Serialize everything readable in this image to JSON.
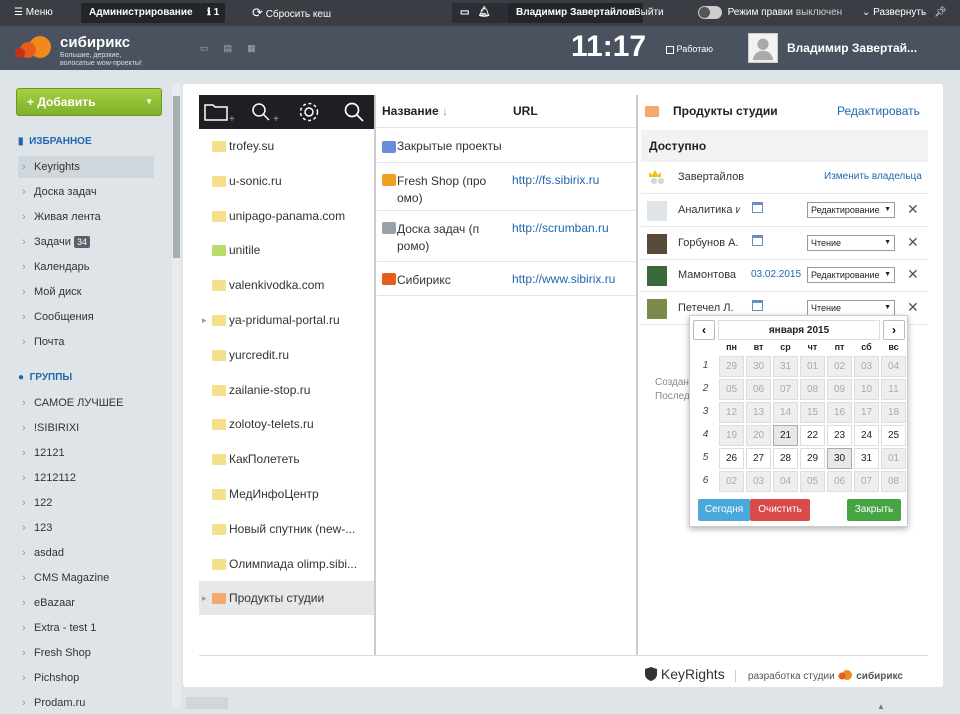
{
  "adminbar": {
    "menu": "Меню",
    "admin": "Администрирование",
    "badge_count": "1",
    "clear_cache": "Сбросить кеш",
    "user": "Владимир Завертайлов",
    "logout": "Выйти",
    "edit_mode_label": "Режим правки",
    "edit_mode_state": "выключен",
    "expand": "Развернуть"
  },
  "header": {
    "logo_name": "сибирикс",
    "logo_tagline_1": "Большие, дерзкие,",
    "logo_tagline_2": "волосатые wow-проекты!",
    "clock": "11:17",
    "working": "Работаю",
    "user_name": "Владимир Завертай..."
  },
  "sidebar": {
    "add_button": "Добавить",
    "favorites_title": "ИЗБРАННОЕ",
    "favorites": [
      {
        "label": "Keyrights"
      },
      {
        "label": "Доска задач"
      },
      {
        "label": "Живая лента"
      },
      {
        "label": "Задачи",
        "count": "34"
      },
      {
        "label": "Календарь"
      },
      {
        "label": "Мой диск"
      },
      {
        "label": "Сообщения"
      },
      {
        "label": "Почта"
      }
    ],
    "groups_title": "ГРУППЫ",
    "groups": [
      {
        "label": "САМОЕ ЛУЧШЕЕ"
      },
      {
        "label": "!SIBIRIXI"
      },
      {
        "label": "12121"
      },
      {
        "label": "1212112"
      },
      {
        "label": "122"
      },
      {
        "label": "123"
      },
      {
        "label": "asdad"
      },
      {
        "label": "CMS Magazine"
      },
      {
        "label": "eBazaar"
      },
      {
        "label": "Extra - test 1"
      },
      {
        "label": "Fresh Shop"
      },
      {
        "label": "Pichshop"
      },
      {
        "label": "Prodam.ru"
      }
    ]
  },
  "folders": [
    {
      "name": "trofey.su",
      "color": "#f5e08a"
    },
    {
      "name": "u-sonic.ru",
      "color": "#f5e08a"
    },
    {
      "name": "unipago-panama.com",
      "color": "#f5e08a"
    },
    {
      "name": "unitile",
      "color": "#b6dd6a"
    },
    {
      "name": "valenkivodka.com",
      "color": "#f5e08a"
    },
    {
      "name": "ya-pridumal-portal.ru",
      "color": "#f5e08a"
    },
    {
      "name": "yurcredit.ru",
      "color": "#f5e08a"
    },
    {
      "name": "zailanie-stop.ru",
      "color": "#f5e08a"
    },
    {
      "name": "zolotoy-telets.ru",
      "color": "#f5e08a"
    },
    {
      "name": "КакПолететь",
      "color": "#f5e08a"
    },
    {
      "name": "МедИнфоЦентр",
      "color": "#f5e08a"
    },
    {
      "name": "Новый спутник (new-...",
      "color": "#f5e08a"
    },
    {
      "name": "Олимпиада olimp.sibi...",
      "color": "#f5e08a"
    },
    {
      "name": "Продукты студии",
      "color": "#f5a86a"
    }
  ],
  "files": {
    "col_name": "Название",
    "col_url": "URL",
    "rows": [
      {
        "name": "Закрытые проекты",
        "url": ""
      },
      {
        "name": "Fresh Shop (про омо)",
        "url": "http://fs.sibirix.ru"
      },
      {
        "name": "Доска задач (п ромо)",
        "url": "http://scrumban.ru"
      },
      {
        "name": "Сибирикс",
        "url": "http://www.sibirix.ru"
      }
    ]
  },
  "access": {
    "title": "Продукты студии",
    "edit": "Редактировать",
    "available": "Доступно",
    "owner_name": "Завертайлов",
    "change_owner": "Изменить владельца",
    "users": [
      {
        "name": "Аналитика и",
        "date": "",
        "perm": "Редактирование"
      },
      {
        "name": "Горбунов А.",
        "date": "",
        "perm": "Чтение"
      },
      {
        "name": "Мамонтова Е",
        "date": "03.02.2015",
        "perm": "Редактирование"
      },
      {
        "name": "Петечел Л.",
        "date": "",
        "perm": "Чтение"
      }
    ],
    "created_label": "Создан",
    "last_label": "Последн"
  },
  "calendar": {
    "month": "января 2015",
    "weekdays": [
      "пн",
      "вт",
      "ср",
      "чт",
      "пт",
      "сб",
      "вс"
    ],
    "weeks": [
      {
        "n": "1",
        "days": [
          "29",
          "30",
          "31",
          "01",
          "02",
          "03",
          "04"
        ],
        "out": [
          1,
          1,
          1,
          1,
          1,
          1,
          1
        ]
      },
      {
        "n": "2",
        "days": [
          "05",
          "06",
          "07",
          "08",
          "09",
          "10",
          "11"
        ],
        "out": [
          1,
          1,
          1,
          1,
          1,
          1,
          1
        ]
      },
      {
        "n": "3",
        "days": [
          "12",
          "13",
          "14",
          "15",
          "16",
          "17",
          "18"
        ],
        "out": [
          1,
          1,
          1,
          1,
          1,
          1,
          1
        ]
      },
      {
        "n": "4",
        "days": [
          "19",
          "20",
          "21",
          "22",
          "23",
          "24",
          "25"
        ],
        "out": [
          1,
          1,
          0,
          0,
          0,
          0,
          0
        ]
      },
      {
        "n": "5",
        "days": [
          "26",
          "27",
          "28",
          "29",
          "30",
          "31",
          "01"
        ],
        "out": [
          0,
          0,
          0,
          0,
          0,
          0,
          1
        ]
      },
      {
        "n": "6",
        "days": [
          "02",
          "03",
          "04",
          "05",
          "06",
          "07",
          "08"
        ],
        "out": [
          1,
          1,
          1,
          1,
          1,
          1,
          1
        ]
      }
    ],
    "today": "Сегодня",
    "clear": "Очистить",
    "close": "Закрыть"
  },
  "footer": {
    "brand": "KeyRights",
    "by": "разработка студии",
    "studio": "сибирикс"
  }
}
